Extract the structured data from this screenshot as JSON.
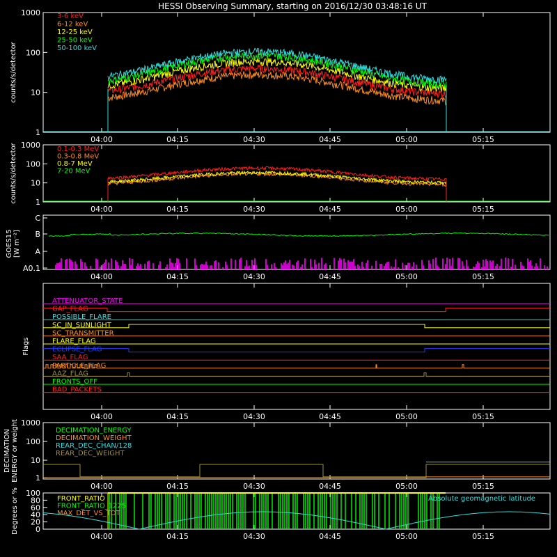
{
  "title": "HESSI Observing Summary, starting on 2016/12/30 03:48:16 UT",
  "time_ticks": [
    "04:00",
    "04:15",
    "04:30",
    "04:45",
    "05:00",
    "05:15"
  ],
  "colors": {
    "red": "#ff2020",
    "orange": "#ff8c1a",
    "yellow": "#ffff00",
    "green": "#00ff00",
    "cyan": "#2fe0e0",
    "magenta": "#ff00ff",
    "blue": "#1a3cff",
    "olive": "#a09030",
    "white": "#ffffff"
  },
  "chart_data": [
    {
      "type": "line",
      "id": "low",
      "ylabel": "counts/s/detector",
      "yticks": [
        "1",
        "10",
        "100",
        "1000"
      ],
      "series": [
        {
          "name": "3-6 keV",
          "color": "#ff2020",
          "peak": 40,
          "base": 9
        },
        {
          "name": "6-12 keV",
          "color": "#ff8c1a",
          "peak": 28,
          "base": 6
        },
        {
          "name": "12-25 keV",
          "color": "#ffff00",
          "peak": 60,
          "base": 12
        },
        {
          "name": "25-50 keV",
          "color": "#00ff00",
          "peak": 85,
          "base": 15
        },
        {
          "name": "50-100 keV",
          "color": "#2fe0e0",
          "peak": 105,
          "base": 20
        }
      ]
    },
    {
      "type": "line",
      "id": "high",
      "ylabel": "counts/s/detector",
      "yticks": [
        "1",
        "10",
        "100",
        "1000"
      ],
      "series": [
        {
          "name": "0.1-0.3 MeV",
          "color": "#ff2020",
          "peak": 60,
          "base": 15
        },
        {
          "name": "0.3-0.8 MeV",
          "color": "#ff8c1a",
          "peak": 30,
          "base": 8
        },
        {
          "name": "0.8-7 MeV",
          "color": "#ffff00",
          "peak": 35,
          "base": 10
        },
        {
          "name": "7-20 MeV",
          "color": "#00ff00",
          "peak": 0,
          "base": 0
        }
      ]
    },
    {
      "type": "line",
      "id": "goes",
      "ylabel": "GOES15",
      "ylabel2": "[W m⁻²]",
      "yticks": [
        "A0.1",
        "A",
        "B",
        "C"
      ]
    },
    {
      "type": "line",
      "id": "flags",
      "ylabel": "Flags",
      "flags": [
        {
          "name": "ATTENUATOR_STATE",
          "color": "#ff00ff"
        },
        {
          "name": "GAP_FLAG",
          "color": "#ff2020"
        },
        {
          "name": "POSSIBLE_FLARE",
          "color": "#2fe0e0"
        },
        {
          "name": "SC_IN_SUNLIGHT",
          "color": "#ffff00"
        },
        {
          "name": "SC_TRANSMITTER",
          "color": "#ff8c1a"
        },
        {
          "name": "FLARE_FLAG",
          "color": "#ffff00"
        },
        {
          "name": "ECLIPSE_FLAG",
          "color": "#1a3cff"
        },
        {
          "name": "SAA_FLAG",
          "color": "#ff2020"
        },
        {
          "name": "PARTICLE_FLAG",
          "color": "#ff8c1a"
        },
        {
          "name": "AAZ_FLAG",
          "color": "#a09030"
        },
        {
          "name": "FRONTS_OFF",
          "color": "#00ff00"
        },
        {
          "name": "BAD_PACKETS",
          "color": "#ff2020"
        }
      ]
    },
    {
      "type": "line",
      "id": "decim",
      "ylabel": "DECIMATION",
      "ylabel2": "ENERGY or weight",
      "yticks": [
        "1",
        "10",
        "100",
        "1000"
      ],
      "series": [
        {
          "name": "DECIMATION_ENERGY",
          "color": "#00ff00"
        },
        {
          "name": "DECIMATION_WEIGHT",
          "color": "#ff8c1a"
        },
        {
          "name": "REAR_DEC_CHAN/128",
          "color": "#2fe0e0"
        },
        {
          "name": "REAR_DEC_WEIGHT",
          "color": "#a09030"
        }
      ]
    },
    {
      "type": "line",
      "id": "ratio",
      "ylabel": "Degrees or %",
      "yticks": [
        "0",
        "20",
        "40",
        "60",
        "80",
        "100"
      ],
      "series": [
        {
          "name": "FRONT_RATIO",
          "color": "#ffff00"
        },
        {
          "name": "FRONT_RATIO_1225",
          "color": "#00ff00"
        },
        {
          "name": "MAX_DET_VS_TOT",
          "color": "#ff8c1a"
        },
        {
          "name": "Absolute geomagnetic latitude",
          "color": "#2fe0e0"
        }
      ]
    }
  ]
}
